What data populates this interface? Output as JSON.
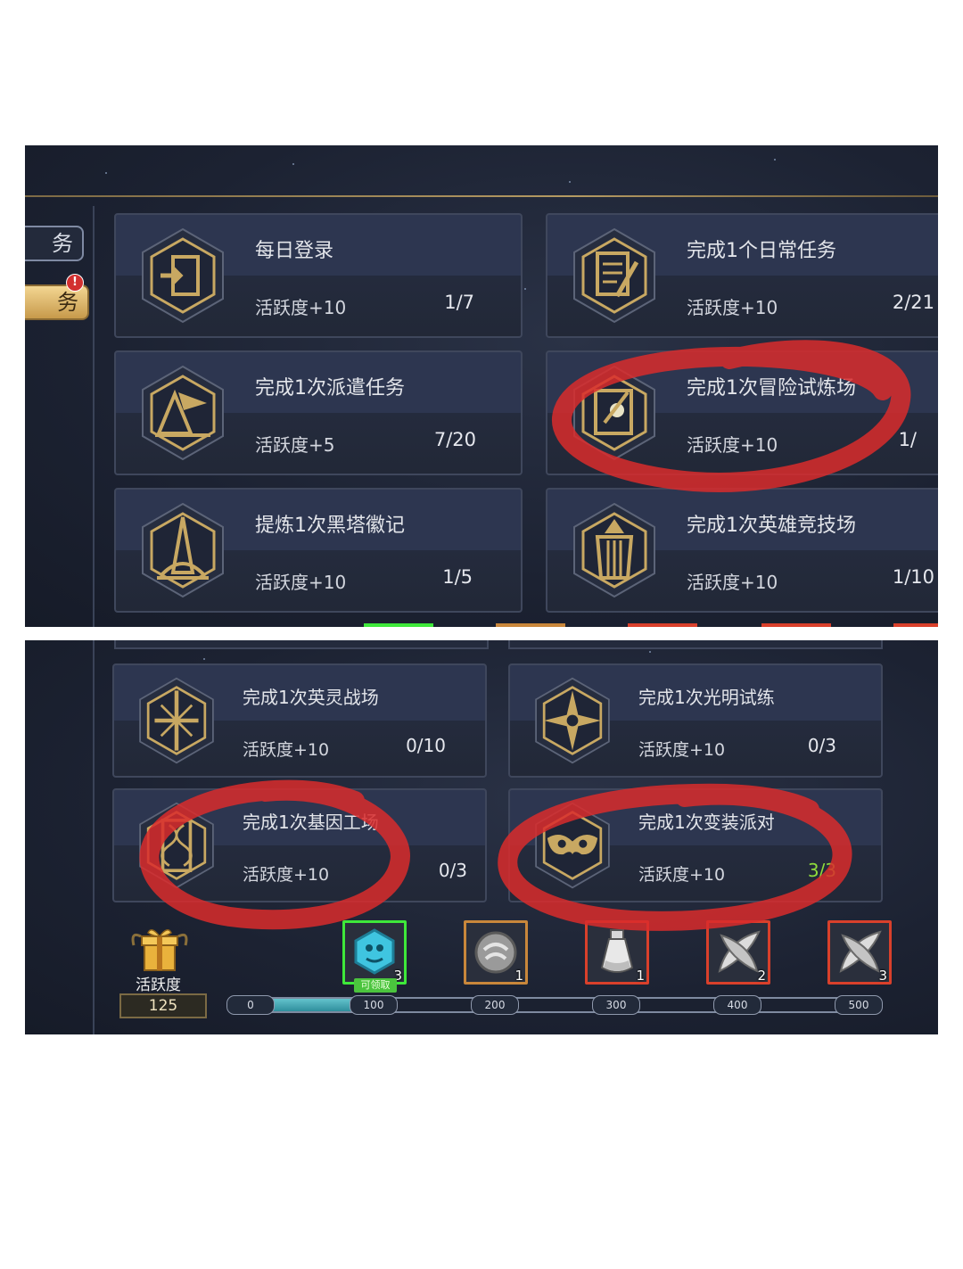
{
  "tabs": [
    {
      "label": "务",
      "active": false
    },
    {
      "label": "务",
      "active": true,
      "badge": "!"
    }
  ],
  "tasks_top": [
    {
      "title": "每日登录",
      "reward": "活跃度+10",
      "progress": "1/7",
      "icon": "login-door-icon"
    },
    {
      "title": "完成1个日常任务",
      "reward": "活跃度+10",
      "progress": "2/21",
      "icon": "scroll-quill-icon"
    },
    {
      "title": "完成1次派遣任务",
      "reward": "活跃度+5",
      "progress": "7/20",
      "icon": "tent-flag-icon"
    },
    {
      "title": "完成1次冒险试炼场",
      "reward": "活跃度+10",
      "progress": "1/",
      "icon": "compass-card-icon"
    },
    {
      "title": "提炼1次黑塔徽记",
      "reward": "活跃度+10",
      "progress": "1/5",
      "icon": "black-tower-icon"
    },
    {
      "title": "完成1次英雄竞技场",
      "reward": "活跃度+10",
      "progress": "1/10",
      "icon": "hero-armor-icon"
    }
  ],
  "tasks_bottom": [
    {
      "title": "完成1次英灵战场",
      "reward": "活跃度+10",
      "progress": "0/10",
      "icon": "sword-cross-icon"
    },
    {
      "title": "完成1次光明试练",
      "reward": "活跃度+10",
      "progress": "0/3",
      "icon": "light-star-icon"
    },
    {
      "title": "完成1次基因工场",
      "reward": "活跃度+10",
      "progress": "0/3",
      "icon": "dna-helix-icon"
    },
    {
      "title": "完成1次变装派对",
      "reward": "活跃度+10",
      "progress": "3/3",
      "icon": "party-mask-icon",
      "complete": true
    }
  ],
  "activity": {
    "label": "活跃度",
    "points": "125",
    "progress_fraction": 0.25,
    "marks": [
      "0",
      "100",
      "200",
      "300",
      "400",
      "500"
    ],
    "claim_label": "可领取"
  },
  "rewards": [
    {
      "icon": "cyan-gem-icon",
      "count": "3",
      "border": "#3ee83a",
      "claimable": true
    },
    {
      "icon": "stone-wind-icon",
      "count": "1",
      "border": "#c9873b"
    },
    {
      "icon": "potion-bottle-icon",
      "count": "1",
      "border": "#d9402b"
    },
    {
      "icon": "crossed-feathers-icon",
      "count": "2",
      "border": "#d9402b"
    },
    {
      "icon": "crossed-feathers-icon",
      "count": "3",
      "border": "#d9402b"
    }
  ],
  "colors": {
    "panel_bg": "#1c2232",
    "gold": "#c8a862",
    "complete_green": "#8fdc3c",
    "annotation_red": "#d92b2b"
  }
}
